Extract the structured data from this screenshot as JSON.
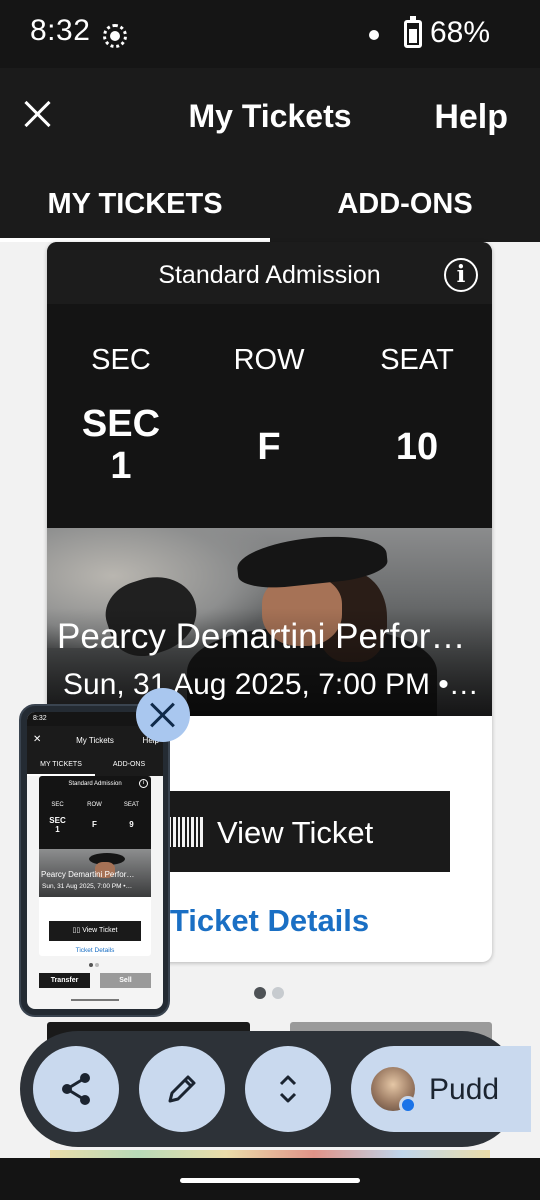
{
  "status_bar": {
    "time": "8:32",
    "battery": "68%"
  },
  "header": {
    "title": "My Tickets",
    "help": "Help"
  },
  "tabs": [
    {
      "label": "MY TICKETS",
      "active": true
    },
    {
      "label": "ADD-ONS",
      "active": false
    }
  ],
  "ticket": {
    "admission": "Standard Admission",
    "columns": [
      {
        "label": "SEC",
        "value": "SEC\n1"
      },
      {
        "label": "ROW",
        "value": "F"
      },
      {
        "label": "SEAT",
        "value": "10"
      }
    ],
    "event_name": "Pearcy Demartini Perfor…",
    "event_date": "Sun, 31 Aug 2025, 7:00 PM •…",
    "view_ticket": "View Ticket",
    "ticket_details": "Ticket Details"
  },
  "pager": {
    "count": 2,
    "active": 1
  },
  "preview": {
    "status_time": "8:32",
    "title": "My Tickets",
    "help": "Help",
    "tab_1": "MY TICKETS",
    "tab_2": "ADD-ONS",
    "admission": "Standard Admission",
    "sec_label": "SEC",
    "row_label": "ROW",
    "seat_label": "SEAT",
    "sec_value": "SEC\n1",
    "row_value": "F",
    "seat_value": "9",
    "event_name": "Pearcy Demartini Perfor…",
    "event_date": "Sun, 31 Aug 2025, 7:00 PM •…",
    "view_ticket": "View Ticket",
    "ticket_details": "Ticket Details",
    "transfer": "Transfer",
    "sell": "Sell"
  },
  "share_sheet": {
    "actions": [
      "share-icon",
      "edit-icon",
      "expand-icon"
    ],
    "contact_name": "Pudd"
  },
  "colors": {
    "link_blue": "#1a6fc4",
    "chip_blue": "#c9d9ee",
    "bar_dark": "#2d3238"
  }
}
